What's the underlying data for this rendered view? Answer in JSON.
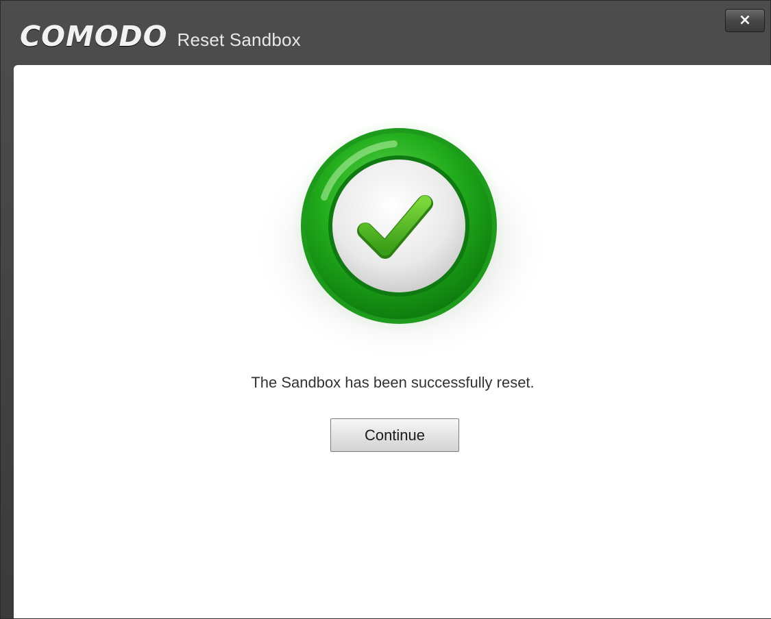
{
  "window": {
    "brand": "COMODO",
    "title": "Reset Sandbox",
    "close_label": "×"
  },
  "dialog": {
    "status_icon": "check-mark-icon",
    "message": "The Sandbox has been successfully reset.",
    "continue_label": "Continue"
  },
  "colors": {
    "titlebar": "#444444",
    "accent_green": "#22b022",
    "check_green": "#5ec41e"
  }
}
